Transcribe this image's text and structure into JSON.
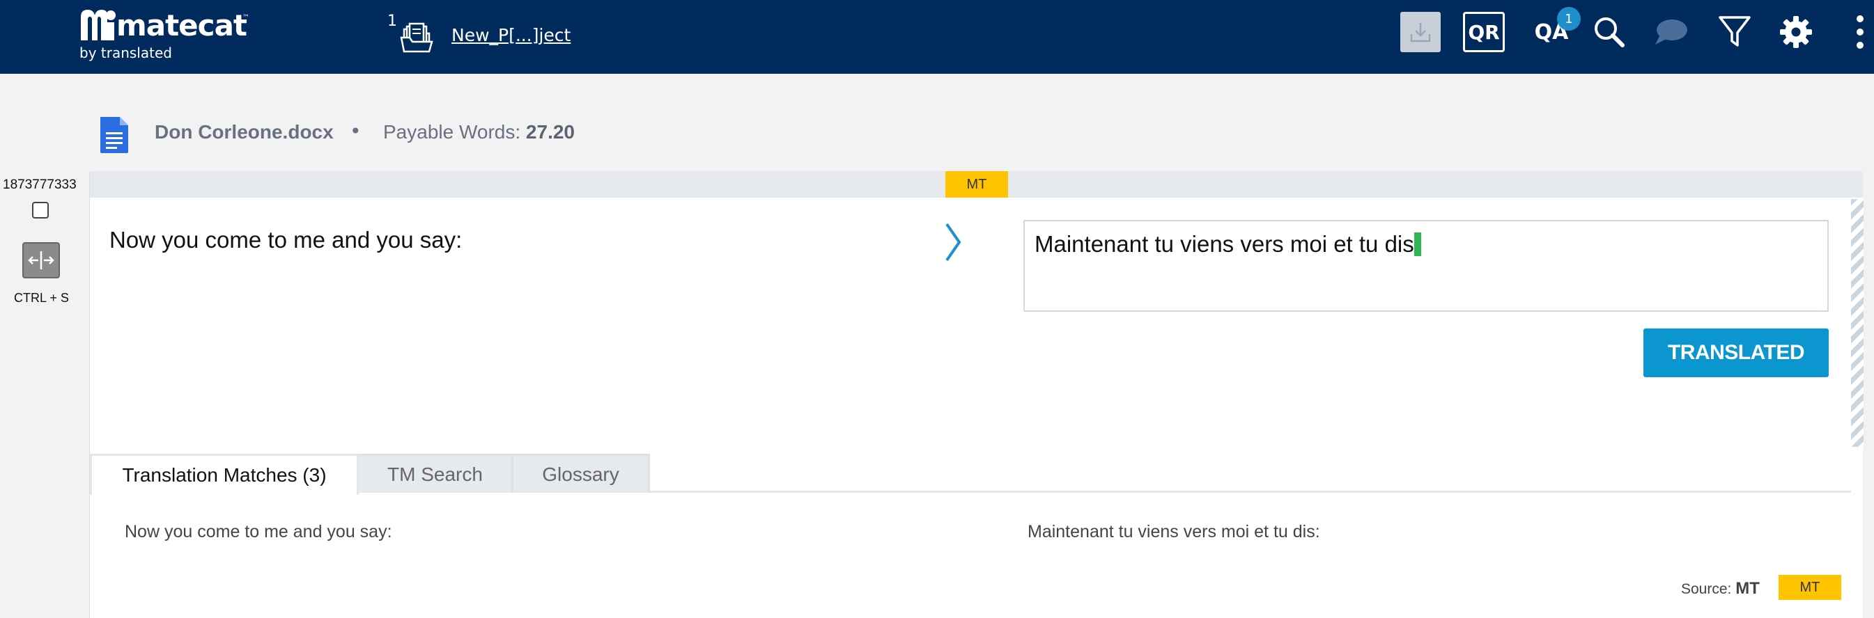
{
  "brand": {
    "name": "matecat",
    "tm": "™",
    "tagline": "by translated"
  },
  "project": {
    "count": "1",
    "name": "New_P[...]ject"
  },
  "toolbar": {
    "qr_label": "QR",
    "qa_label": "QA",
    "qa_badge": "1",
    "icons": [
      "download-icon",
      "search-icon",
      "comment-icon",
      "filter-icon",
      "gear-icon",
      "more-vertical-icon"
    ]
  },
  "file": {
    "name": "Don Corleone.docx",
    "separator": "•",
    "payable_label": "Payable Words:",
    "payable_value": "27.20"
  },
  "segment": {
    "id": "1873777333",
    "shortcut": "CTRL + S",
    "tag": "MT",
    "source": "Now you come to me and you say:",
    "target": "Maintenant tu viens vers moi et tu dis",
    "status_button": "TRANSLATED"
  },
  "tabs": [
    {
      "label": "Translation Matches (3)",
      "active": true
    },
    {
      "label": "TM Search",
      "active": false
    },
    {
      "label": "Glossary",
      "active": false
    }
  ],
  "match": {
    "source": "Now you come to me and you say:",
    "target": "Maintenant tu viens vers moi et tu dis:",
    "source_prefix": "Source:",
    "source_value": "MT",
    "badge": "MT"
  },
  "colors": {
    "topbar": "#002b5c",
    "accent": "#0c96cf",
    "mt_yellow": "#fec400",
    "cursor_green": "#2db556"
  }
}
